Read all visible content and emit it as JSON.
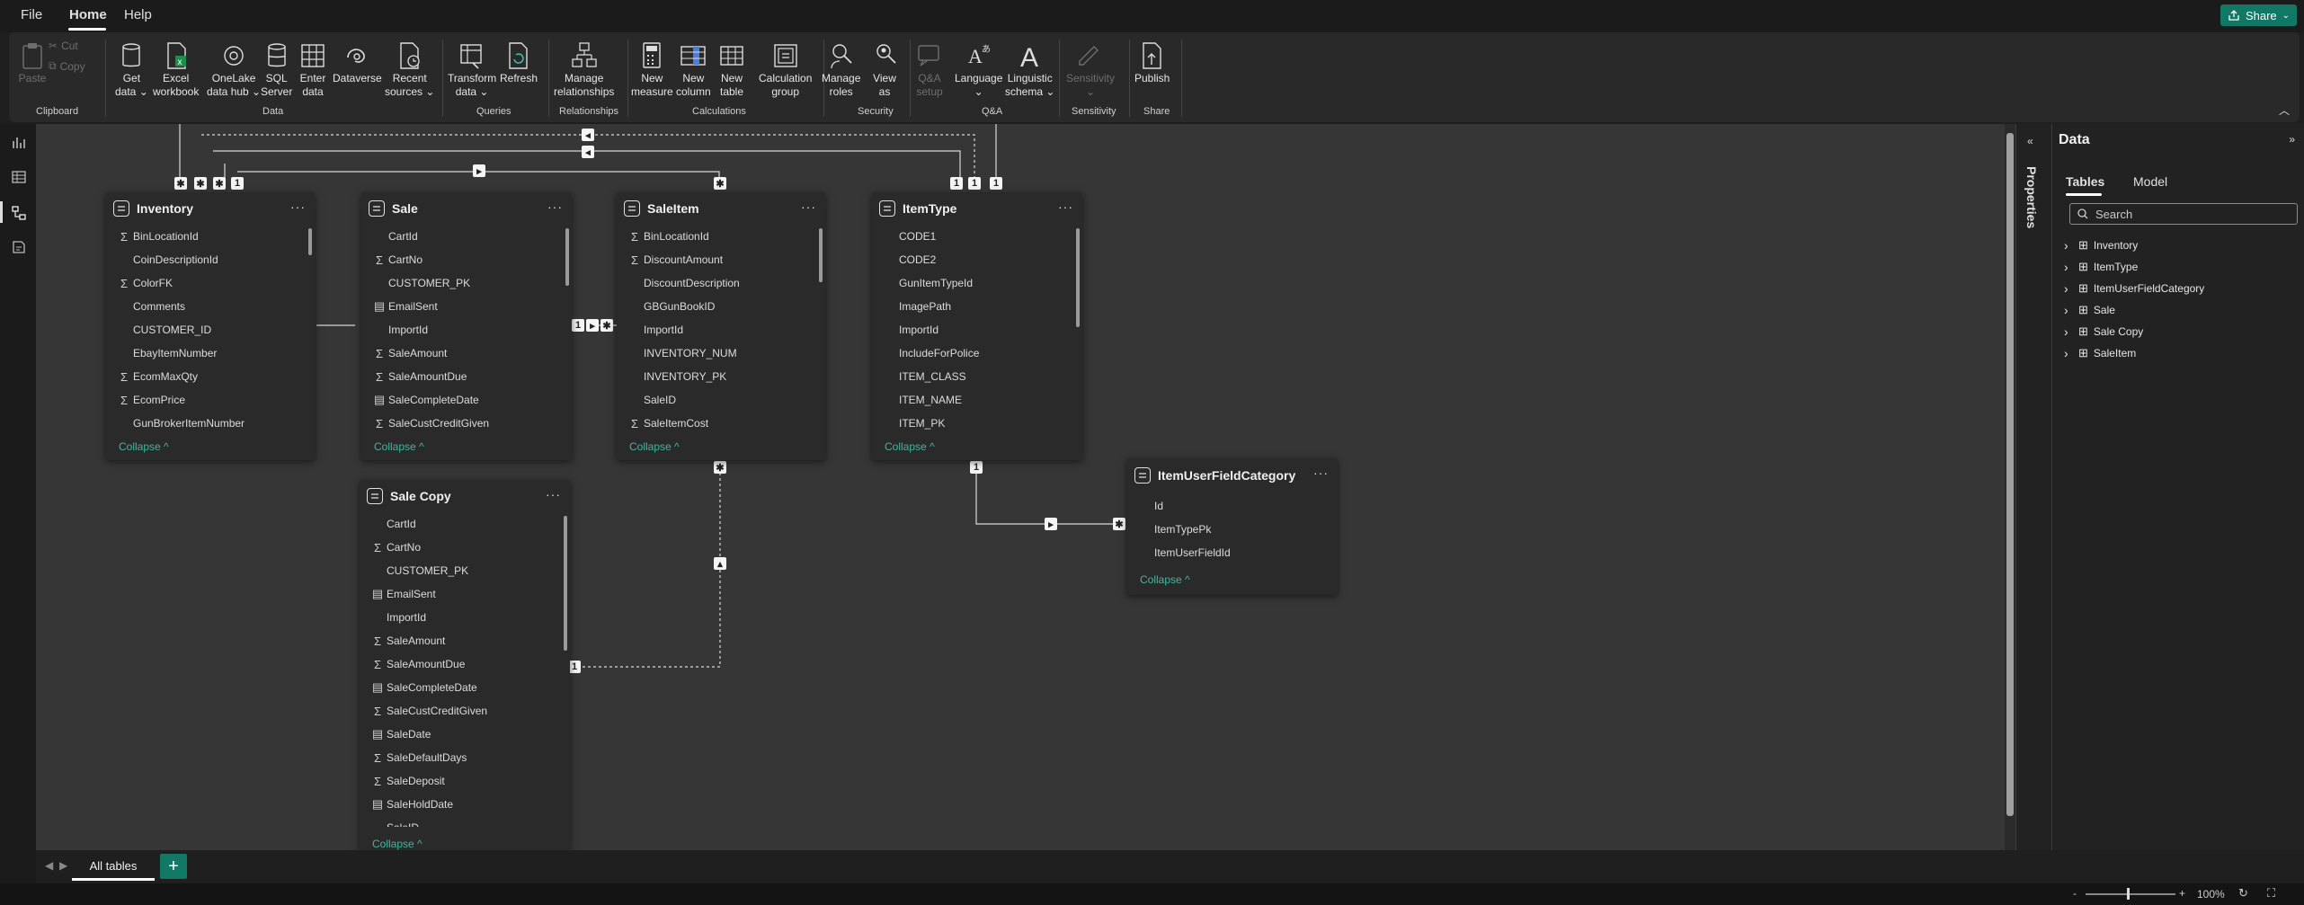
{
  "menu": {
    "file": "File",
    "home": "Home",
    "help": "Help",
    "share": "Share"
  },
  "ribbon": {
    "clipboard": {
      "paste": "Paste",
      "cut": "Cut",
      "copy": "Copy",
      "group": "Clipboard"
    },
    "data": {
      "get_data": "Get\ndata ⌄",
      "excel": "Excel\nworkbook",
      "onelake": "OneLake\ndata hub ⌄",
      "sql": "SQL\nServer",
      "enter": "Enter\ndata",
      "dataverse": "Dataverse",
      "recent": "Recent\nsources ⌄",
      "group": "Data"
    },
    "queries": {
      "transform": "Transform\ndata ⌄",
      "refresh": "Refresh",
      "group": "Queries"
    },
    "relationships": {
      "manage": "Manage\nrelationships",
      "group": "Relationships"
    },
    "calculations": {
      "measure": "New\nmeasure",
      "column": "New\ncolumn",
      "table": "New\ntable",
      "calc_group": "Calculation\ngroup",
      "group": "Calculations"
    },
    "security": {
      "roles": "Manage\nroles",
      "view_as": "View\nas",
      "group": "Security"
    },
    "qa": {
      "setup": "Q&A\nsetup",
      "language": "Language\n⌄",
      "schema": "Linguistic\nschema ⌄",
      "group": "Q&A"
    },
    "sensitivity": {
      "label": "Sensitivity\n⌄",
      "group": "Sensitivity"
    },
    "share": {
      "publish": "Publish",
      "group": "Share"
    }
  },
  "tables": {
    "inventory": {
      "name": "Inventory",
      "fields": [
        {
          "name": "BinLocationId",
          "sigma": true
        },
        {
          "name": "CoinDescriptionId",
          "sigma": false
        },
        {
          "name": "ColorFK",
          "sigma": true
        },
        {
          "name": "Comments",
          "sigma": false
        },
        {
          "name": "CUSTOMER_ID",
          "sigma": false
        },
        {
          "name": "EbayItemNumber",
          "sigma": false
        },
        {
          "name": "EcomMaxQty",
          "sigma": true
        },
        {
          "name": "EcomPrice",
          "sigma": true
        },
        {
          "name": "GunBrokerItemNumber",
          "sigma": false
        }
      ],
      "collapse": "Collapse ^"
    },
    "sale": {
      "name": "Sale",
      "fields": [
        {
          "name": "CartId",
          "sigma": false
        },
        {
          "name": "CartNo",
          "sigma": true
        },
        {
          "name": "CUSTOMER_PK",
          "sigma": false
        },
        {
          "name": "EmailSent",
          "cal": true
        },
        {
          "name": "ImportId",
          "sigma": false
        },
        {
          "name": "SaleAmount",
          "sigma": true
        },
        {
          "name": "SaleAmountDue",
          "sigma": true
        },
        {
          "name": "SaleCompleteDate",
          "cal": true
        },
        {
          "name": "SaleCustCreditGiven",
          "sigma": true
        }
      ],
      "collapse": "Collapse ^"
    },
    "saleitem": {
      "name": "SaleItem",
      "fields": [
        {
          "name": "BinLocationId",
          "sigma": true
        },
        {
          "name": "DiscountAmount",
          "sigma": true
        },
        {
          "name": "DiscountDescription",
          "sigma": false
        },
        {
          "name": "GBGunBookID",
          "sigma": false
        },
        {
          "name": "ImportId",
          "sigma": false
        },
        {
          "name": "INVENTORY_NUM",
          "sigma": false
        },
        {
          "name": "INVENTORY_PK",
          "sigma": false
        },
        {
          "name": "SaleID",
          "sigma": false
        },
        {
          "name": "SaleItemCost",
          "sigma": true
        }
      ],
      "collapse": "Collapse ^"
    },
    "itemtype": {
      "name": "ItemType",
      "fields": [
        {
          "name": "CODE1",
          "sigma": false
        },
        {
          "name": "CODE2",
          "sigma": false
        },
        {
          "name": "GunItemTypeId",
          "sigma": false
        },
        {
          "name": "ImagePath",
          "sigma": false
        },
        {
          "name": "ImportId",
          "sigma": false
        },
        {
          "name": "IncludeForPolice",
          "sigma": false
        },
        {
          "name": "ITEM_CLASS",
          "sigma": false
        },
        {
          "name": "ITEM_NAME",
          "sigma": false
        },
        {
          "name": "ITEM_PK",
          "sigma": false
        }
      ],
      "collapse": "Collapse ^"
    },
    "salecopy": {
      "name": "Sale Copy",
      "fields": [
        {
          "name": "CartId",
          "sigma": false
        },
        {
          "name": "CartNo",
          "sigma": true
        },
        {
          "name": "CUSTOMER_PK",
          "sigma": false
        },
        {
          "name": "EmailSent",
          "cal": true
        },
        {
          "name": "ImportId",
          "sigma": false
        },
        {
          "name": "SaleAmount",
          "sigma": true
        },
        {
          "name": "SaleAmountDue",
          "sigma": true
        },
        {
          "name": "SaleCompleteDate",
          "cal": true
        },
        {
          "name": "SaleCustCreditGiven",
          "sigma": true
        },
        {
          "name": "SaleDate",
          "cal": true
        },
        {
          "name": "SaleDefaultDays",
          "sigma": true
        },
        {
          "name": "SaleDeposit",
          "sigma": true
        },
        {
          "name": "SaleHoldDate",
          "cal": true
        },
        {
          "name": "SaleID",
          "sigma": false
        }
      ],
      "collapse": "Collapse ^"
    },
    "iufc": {
      "name": "ItemUserFieldCategory",
      "fields": [
        {
          "name": "Id",
          "sigma": false
        },
        {
          "name": "ItemTypePk",
          "sigma": false
        },
        {
          "name": "ItemUserFieldId",
          "sigma": false
        }
      ],
      "collapse": "Collapse ^"
    }
  },
  "cardinality": {
    "one": "1",
    "many": "✱"
  },
  "properties_pane": {
    "title": "Properties"
  },
  "data_pane": {
    "title": "Data",
    "tab_tables": "Tables",
    "tab_model": "Model",
    "search_placeholder": "Search",
    "items": [
      "Inventory",
      "ItemType",
      "ItemUserFieldCategory",
      "Sale",
      "Sale Copy",
      "SaleItem"
    ]
  },
  "bottom": {
    "tab_all": "All tables",
    "add": "+"
  },
  "status": {
    "zoom": "100%",
    "minus": "-",
    "plus": "+"
  },
  "colors": {
    "accent": "#117865",
    "link": "#3fb89c",
    "canvas": "#363636"
  }
}
